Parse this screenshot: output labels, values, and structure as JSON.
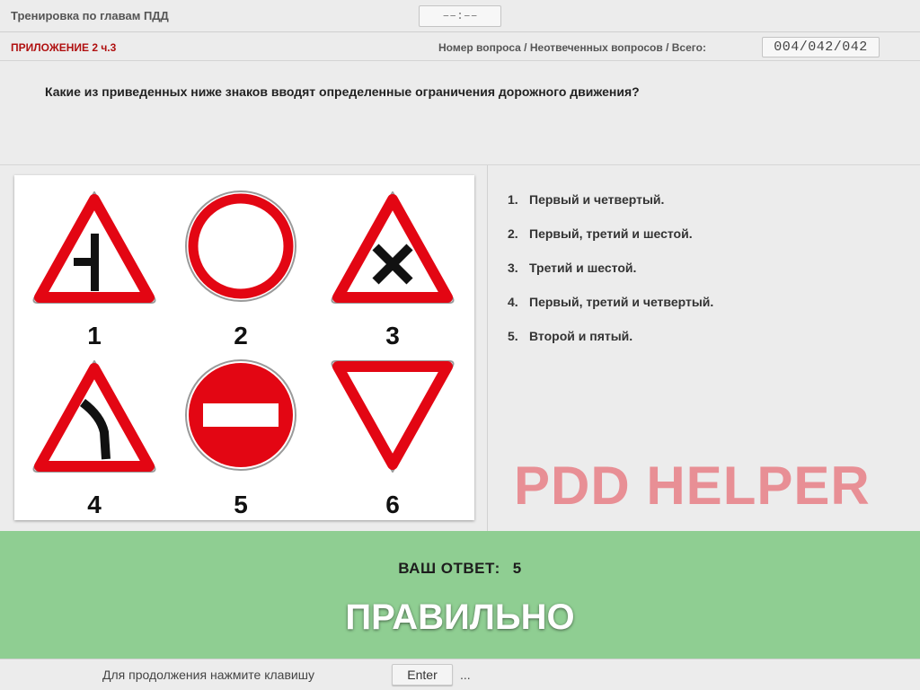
{
  "header": {
    "title": "Тренировка по главам ПДД",
    "timer": "––:––"
  },
  "info": {
    "section": "ПРИЛОЖЕНИЕ 2 ч.3",
    "counter_label": "Номер вопроса / Неотвеченных вопросов / Всего:",
    "counter_value": "004/042/042"
  },
  "question": {
    "text": "Какие из приведенных ниже знаков вводят определенные ограничения дорожного движения?"
  },
  "signs": {
    "labels": [
      "1",
      "2",
      "3",
      "4",
      "5",
      "6"
    ],
    "colors": {
      "red": "#e30613",
      "white": "#ffffff",
      "black": "#111111"
    }
  },
  "answers": [
    {
      "num": "1.",
      "text": "Первый и четвертый."
    },
    {
      "num": "2.",
      "text": "Первый, третий и шестой."
    },
    {
      "num": "3.",
      "text": "Третий и шестой."
    },
    {
      "num": "4.",
      "text": "Первый, третий и четвертый."
    },
    {
      "num": "5.",
      "text": "Второй и пятый."
    }
  ],
  "watermark": "PDD HELPER",
  "result": {
    "label": "ВАШ ОТВЕТ:",
    "value": "5",
    "verdict": "ПРАВИЛЬНО",
    "color": "#8fce92"
  },
  "footer": {
    "prompt": "Для продолжения нажмите клавишу",
    "key": "Enter",
    "suffix": "..."
  }
}
